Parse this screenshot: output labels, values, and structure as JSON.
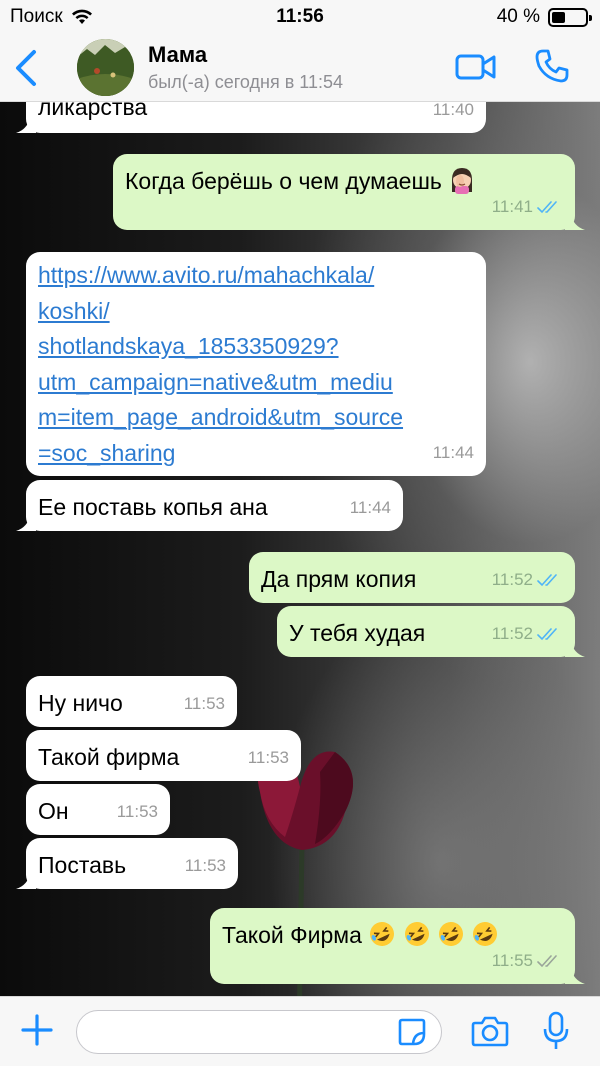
{
  "status_bar": {
    "carrier": "Поиск",
    "time": "11:56",
    "battery_text": "40 %",
    "battery_level": 0.4
  },
  "header": {
    "contact_name": "Мама",
    "contact_status": "был(-а) сегодня в 11:54"
  },
  "colors": {
    "accent": "#1a8cff",
    "outgoing_bubble": "#dcf8c6",
    "incoming_bubble": "#ffffff",
    "link": "#2c7bd1",
    "read_ticks": "#4fb4f7"
  },
  "messages": [
    {
      "direction": "in",
      "text": "ликарства",
      "time": "11:40"
    },
    {
      "direction": "out",
      "text": "Когда берёшь о чем думаешь",
      "emoji": "woman-facepalming",
      "time": "11:41",
      "status": "read"
    },
    {
      "direction": "in",
      "link_lines": [
        "https://www.avito.ru/mahachkala/",
        "koshki/",
        "shotlandskaya_1853350929?",
        "utm_campaign=native&utm_mediu",
        "m=item_page_android&utm_source",
        "=soc_sharing"
      ],
      "time": "11:44"
    },
    {
      "direction": "in",
      "text": "Ее поставь копья ана",
      "time": "11:44"
    },
    {
      "direction": "out",
      "text": "Да прям копия",
      "time": "11:52",
      "status": "read"
    },
    {
      "direction": "out",
      "text": "У тебя худая",
      "time": "11:52",
      "status": "read"
    },
    {
      "direction": "in",
      "text": "Ну ничо",
      "time": "11:53"
    },
    {
      "direction": "in",
      "text": "Такой фирма",
      "time": "11:53"
    },
    {
      "direction": "in",
      "text": "Он",
      "time": "11:53"
    },
    {
      "direction": "in",
      "text": "Поставь",
      "time": "11:53"
    },
    {
      "direction": "out",
      "text": "Такой Фирма",
      "emoji": "rolling-on-the-floor-laughing x4",
      "time": "11:55",
      "status": "delivered"
    }
  ],
  "input": {
    "placeholder": ""
  },
  "icons": {
    "wifi": "wifi-icon",
    "back": "chevron-left-icon",
    "video": "video-camera-icon",
    "call": "phone-icon",
    "plus": "plus-icon",
    "sticker": "sticker-icon",
    "camera": "camera-icon",
    "mic": "microphone-icon"
  }
}
